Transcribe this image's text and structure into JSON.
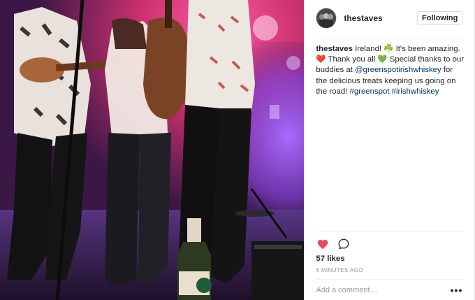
{
  "post": {
    "username": "thestaves",
    "follow_label": "Following",
    "caption": {
      "user": "thestaves",
      "part1": " Ireland! ",
      "emoji1": "☘️",
      "part2": " It's been amazing. ",
      "emoji2": "❤️",
      "part3": " Thank you all ",
      "emoji3": "💚",
      "part4": " Special thanks to our buddies at ",
      "mention": "@greenspotirishwhiskey",
      "part5": " for the delicious treats keeping us going on the road! ",
      "tag1": "#greenspot",
      "tag2": "#irishwhiskey"
    },
    "likes": "57 likes",
    "timestamp": "6 minutes ago",
    "comment_placeholder": "Add a comment…",
    "more_label": "•••",
    "bottle_label": "GREEN SPOT"
  },
  "colors": {
    "heart": "#ed4956",
    "link": "#003569",
    "muted": "#999999"
  },
  "icons": [
    "heart-icon",
    "comment-icon",
    "more-options-icon"
  ]
}
